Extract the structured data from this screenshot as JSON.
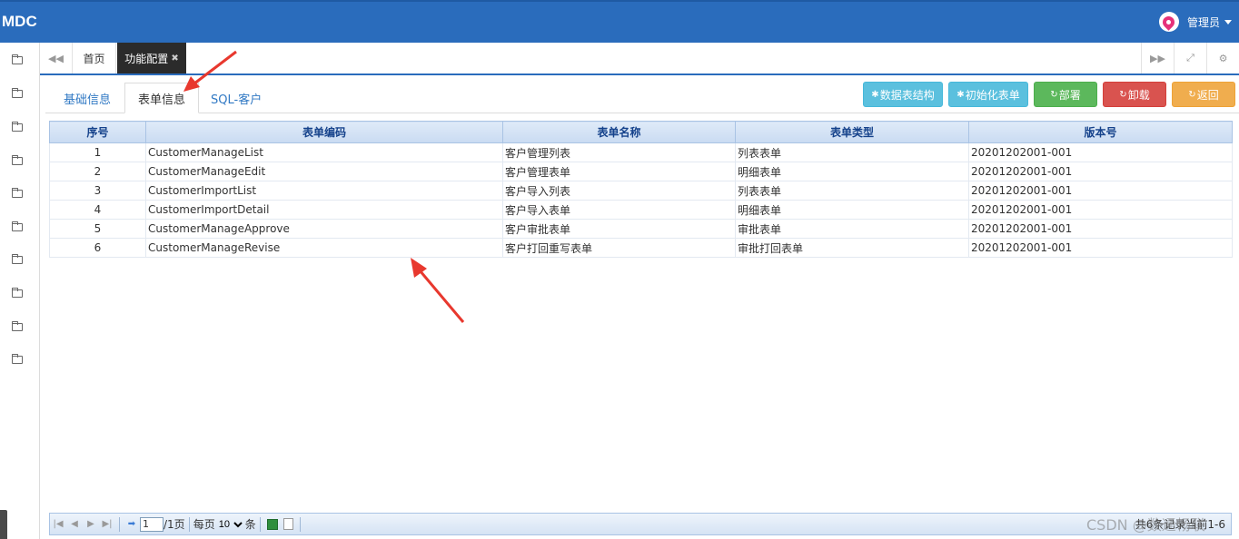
{
  "app": {
    "brand": "MDC",
    "user_name": "管理员"
  },
  "page_tabs": {
    "home": "首页",
    "active": "功能配置",
    "close": "✖"
  },
  "inner_tabs": [
    "基础信息",
    "表单信息",
    "SQL-客户"
  ],
  "actions": [
    {
      "label": "数据表结构",
      "icon": "✱",
      "color": "#5bc0de"
    },
    {
      "label": "初始化表单",
      "icon": "✱",
      "color": "#5bc0de"
    },
    {
      "label": "部署",
      "icon": "↻",
      "color": "#5cb85c"
    },
    {
      "label": "卸载",
      "icon": "↻",
      "color": "#d9534f"
    },
    {
      "label": "返回",
      "icon": "↻",
      "color": "#f0ad4e"
    }
  ],
  "grid": {
    "columns": [
      "序号",
      "表单编码",
      "表单名称",
      "表单类型",
      "版本号"
    ],
    "rows": [
      [
        "1",
        "CustomerManageList",
        "客户管理列表",
        "列表表单",
        "20201202001-001"
      ],
      [
        "2",
        "CustomerManageEdit",
        "客户管理表单",
        "明细表单",
        "20201202001-001"
      ],
      [
        "3",
        "CustomerImportList",
        "客户导入列表",
        "列表表单",
        "20201202001-001"
      ],
      [
        "4",
        "CustomerImportDetail",
        "客户导入表单",
        "明细表单",
        "20201202001-001"
      ],
      [
        "5",
        "CustomerManageApprove",
        "客户审批表单",
        "审批表单",
        "20201202001-001"
      ],
      [
        "6",
        "CustomerManageRevise",
        "客户打回重写表单",
        "审批打回表单",
        "20201202001-001"
      ]
    ]
  },
  "pager": {
    "page_input": "1",
    "page_total": "/1页",
    "per_page_label": "每页",
    "per_page_value": "10",
    "per_page_unit": "条",
    "info": "共6条记录当前1-6"
  },
  "watermark": "CSDN @数通畅联"
}
